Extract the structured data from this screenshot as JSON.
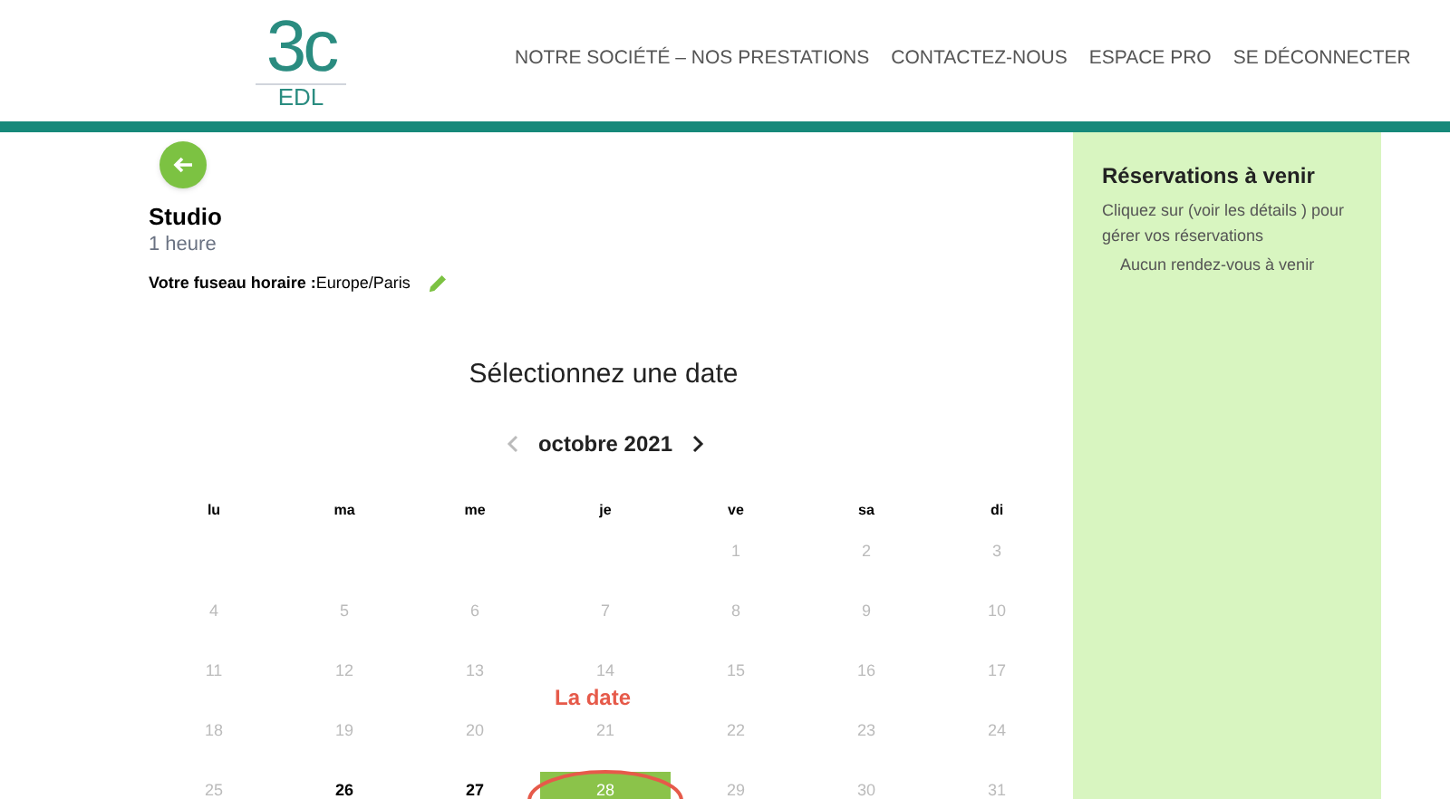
{
  "logo": {
    "mark": "3c",
    "name": "EDL"
  },
  "nav": [
    "NOTRE SOCIÉTÉ – NOS PRESTATIONS",
    "CONTACTEZ-NOUS",
    "ESPACE PRO",
    "SE DÉCONNECTER"
  ],
  "service": {
    "title": "Studio",
    "duration": "1 heure",
    "timezone_label": "Votre fuseau horaire :",
    "timezone": "Europe/Paris"
  },
  "calendar": {
    "heading": "Sélectionnez une date",
    "month": "octobre 2021",
    "prev_disabled": true,
    "weekdays": [
      "lu",
      "ma",
      "me",
      "je",
      "ve",
      "sa",
      "di"
    ],
    "days": [
      {
        "label": "1",
        "available": false,
        "selected": false
      },
      {
        "label": "2",
        "available": false,
        "selected": false
      },
      {
        "label": "3",
        "available": false,
        "selected": false
      },
      {
        "label": "4",
        "available": false,
        "selected": false
      },
      {
        "label": "5",
        "available": false,
        "selected": false
      },
      {
        "label": "6",
        "available": false,
        "selected": false
      },
      {
        "label": "7",
        "available": false,
        "selected": false
      },
      {
        "label": "8",
        "available": false,
        "selected": false
      },
      {
        "label": "9",
        "available": false,
        "selected": false
      },
      {
        "label": "10",
        "available": false,
        "selected": false
      },
      {
        "label": "11",
        "available": false,
        "selected": false
      },
      {
        "label": "12",
        "available": false,
        "selected": false
      },
      {
        "label": "13",
        "available": false,
        "selected": false
      },
      {
        "label": "14",
        "available": false,
        "selected": false
      },
      {
        "label": "15",
        "available": false,
        "selected": false
      },
      {
        "label": "16",
        "available": false,
        "selected": false
      },
      {
        "label": "17",
        "available": false,
        "selected": false
      },
      {
        "label": "18",
        "available": false,
        "selected": false
      },
      {
        "label": "19",
        "available": false,
        "selected": false
      },
      {
        "label": "20",
        "available": false,
        "selected": false
      },
      {
        "label": "21",
        "available": false,
        "selected": false
      },
      {
        "label": "22",
        "available": false,
        "selected": false
      },
      {
        "label": "23",
        "available": false,
        "selected": false
      },
      {
        "label": "24",
        "available": false,
        "selected": false
      },
      {
        "label": "25",
        "available": false,
        "selected": false
      },
      {
        "label": "26",
        "available": true,
        "selected": false
      },
      {
        "label": "27",
        "available": true,
        "selected": false
      },
      {
        "label": "28",
        "available": true,
        "selected": true
      },
      {
        "label": "29",
        "available": false,
        "selected": false
      },
      {
        "label": "30",
        "available": false,
        "selected": false
      },
      {
        "label": "31",
        "available": false,
        "selected": false
      }
    ],
    "annotation": "La date"
  },
  "sidebar": {
    "title": "Réservations à venir",
    "hint": "Cliquez sur (voir les détails ) pour gérer vos réservations",
    "empty": "Aucun rendez-vous à venir"
  }
}
